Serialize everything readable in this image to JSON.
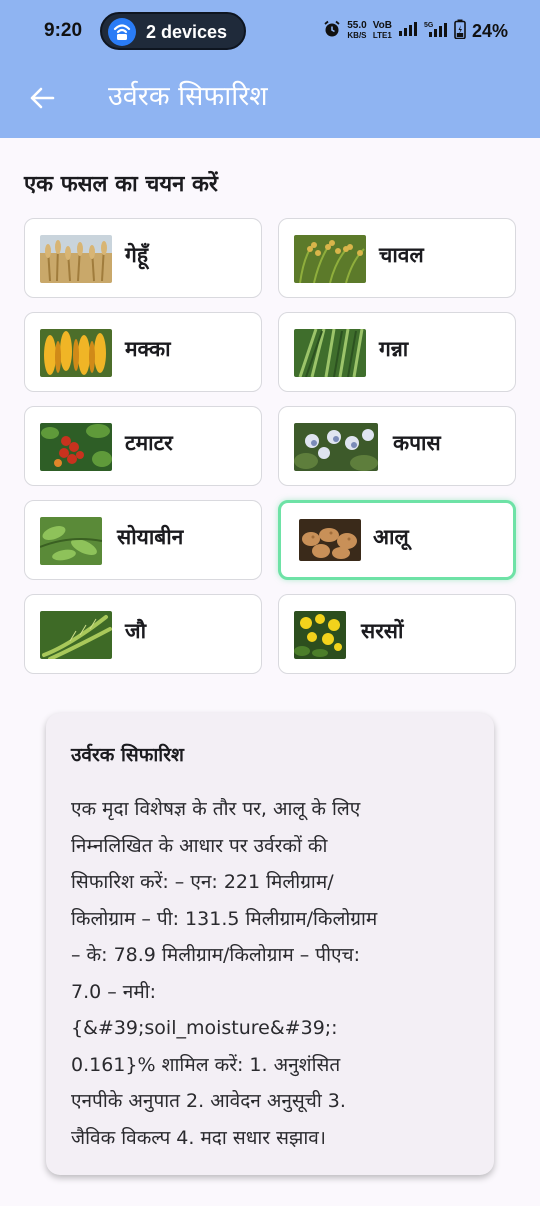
{
  "status_bar": {
    "time": "9:20",
    "hotspot_label": "2 devices",
    "net_speed_value": "55.0",
    "net_speed_unit": "KB/S",
    "volte_line1": "VoB",
    "volte_line2": "LTE1",
    "battery_percent": "24%"
  },
  "app_bar": {
    "title": "उर्वरक सिफारिश",
    "background": "#8fb4f2"
  },
  "crop_section": {
    "title": "एक फसल का चयन करें",
    "selected_index": 7,
    "crops": [
      {
        "label": "गेहूँ",
        "image": "wheat-field"
      },
      {
        "label": "चावल",
        "image": "rice-plants"
      },
      {
        "label": "मक्का",
        "image": "maize-cobs"
      },
      {
        "label": "गन्ना",
        "image": "sugarcane"
      },
      {
        "label": "टमाटर",
        "image": "tomato-plant"
      },
      {
        "label": "कपास",
        "image": "cotton-bolls"
      },
      {
        "label": "सोयाबीन",
        "image": "soybean-pods"
      },
      {
        "label": "आलू",
        "image": "potatoes"
      },
      {
        "label": "जौ",
        "image": "barley"
      },
      {
        "label": "सरसों",
        "image": "mustard-flowers"
      }
    ]
  },
  "recommendation": {
    "title": "उर्वरक सिफारिश",
    "lines": [
      "एक मृदा विशेषज्ञ के तौर पर, आलू के लिए",
      "निम्नलिखित के आधार पर उर्वरकों की",
      "सिफारिश करें: – एन: 221 मिलीग्राम/",
      "किलोग्राम – पी: 131.5 मिलीग्राम/किलोग्राम",
      "– के: 78.9 मिलीग्राम/किलोग्राम – पीएच:",
      "7.0 – नमी:",
      "{&#39;soil_moisture&#39;:",
      "0.161}% शामिल करें: 1. अनुशंसित",
      "एनपीके अनुपात 2. आवेदन अनुसूची 3.",
      "जैविक विकल्प 4. मदा सधार सझाव।"
    ]
  },
  "colors": {
    "selected_border": "#6ee2a6",
    "card_background": "#f3eff5",
    "page_background": "#fbf8fd"
  }
}
